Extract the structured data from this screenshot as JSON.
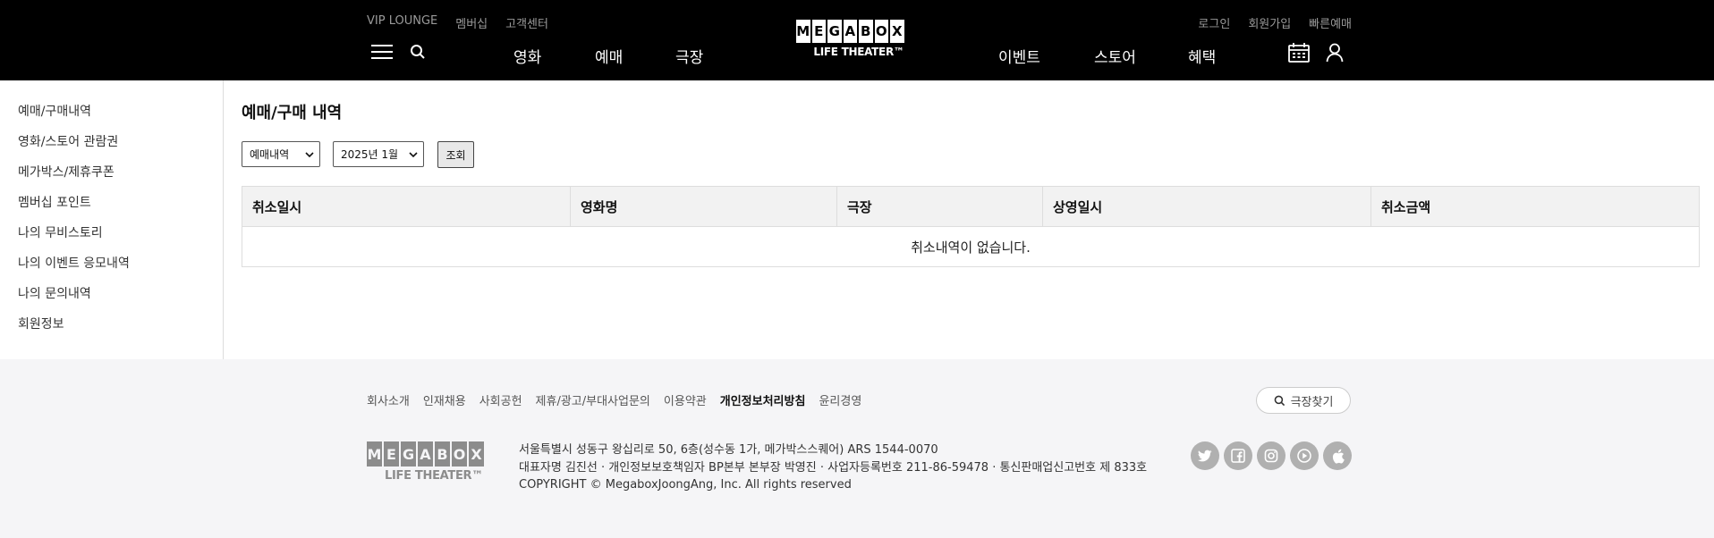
{
  "header": {
    "util_left": [
      "VIP LOUNGE",
      "멤버십",
      "고객센터"
    ],
    "util_right": [
      "로그인",
      "회원가입",
      "빠른예매"
    ],
    "nav_left": [
      "영화",
      "예매",
      "극장"
    ],
    "nav_right": [
      "이벤트",
      "스토어",
      "혜택"
    ],
    "logo_letters": [
      "M",
      "E",
      "G",
      "A",
      "B",
      "O",
      "X"
    ],
    "logo_sub": "LIFE THEATER™"
  },
  "sidebar": {
    "items": [
      "예매/구매내역",
      "영화/스토어 관람권",
      "메가박스/제휴쿠폰",
      "멤버십 포인트",
      "나의 무비스토리",
      "나의 이벤트 응모내역",
      "나의 문의내역",
      "회원정보"
    ]
  },
  "main": {
    "title": "예매/구매 내역",
    "filter_type": "예매내역",
    "filter_month": "2025년 1월",
    "query_button": "조회",
    "columns": [
      "취소일시",
      "영화명",
      "극장",
      "상영일시",
      "취소금액"
    ],
    "empty_message": "취소내역이 없습니다."
  },
  "footer": {
    "links": [
      "회사소개",
      "인재채용",
      "사회공헌",
      "제휴/광고/부대사업문의",
      "이용약관",
      "개인정보처리방침",
      "윤리경영"
    ],
    "find_theater": "극장찾기",
    "address": "서울특별시 성동구 왕십리로 50, 6층(성수동 1가, 메가박스스퀘어) ARS 1544-0070",
    "ceo_line": "대표자명 김진선 · 개인정보보호책임자 BP본부 본부장 박영진 · 사업자등록번호 211-86-59478 · 통신판매업신고번호 제 833호",
    "copyright": "COPYRIGHT © MegaboxJoongAng, Inc. All rights reserved",
    "sns": [
      "twitter-icon",
      "facebook-icon",
      "instagram-icon",
      "youtube-icon",
      "apple-icon"
    ]
  }
}
